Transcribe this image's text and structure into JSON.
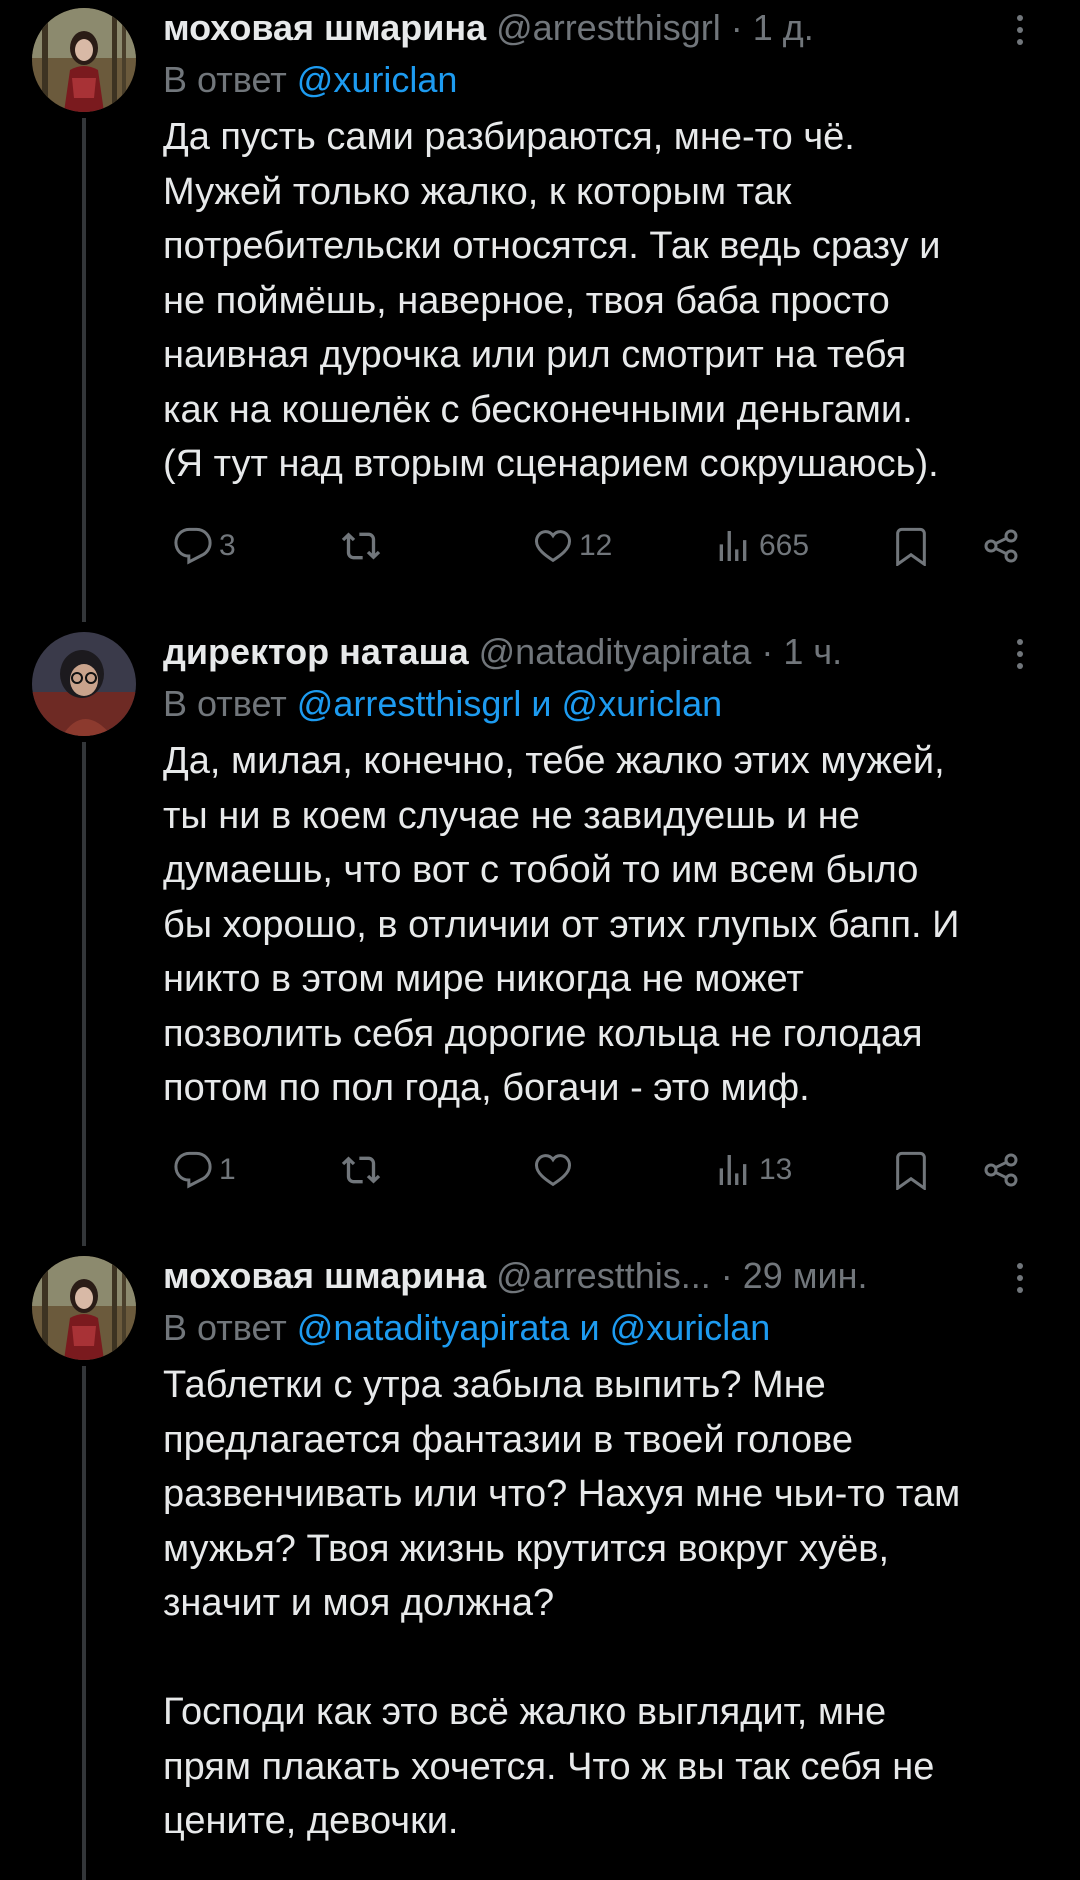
{
  "theme": {
    "background": "#000000",
    "text": "#e7e9ea",
    "muted": "#71767b",
    "accent": "#1d9bf0",
    "thread_line": "#333639"
  },
  "tweets": [
    {
      "name": "моховая шмарина",
      "handle": "@arrestthisgrl",
      "separator": "·",
      "time": "1 д.",
      "reply_prefix": "В ответ",
      "reply_mentions": [
        "@xuriclan"
      ],
      "reply_joiner": "",
      "text_lines": [
        "Да пусть сами разбираются, мне-то чё.",
        "Мужей только жалко, к которым так",
        "потребительски относятся. Так ведь сразу и",
        "не поймёшь, наверное, твоя баба просто",
        "наивная дурочка или рил смотрит на тебя",
        "как на кошелёк с бесконечными деньгами.",
        "(Я тут над вторым сценарием сокрушаюсь)."
      ],
      "replies": "3",
      "retweets": "",
      "likes": "12",
      "views": "665",
      "avatar_icon": "avatar-girl-forest"
    },
    {
      "name": "директор наташа",
      "handle": "@nataдityapirata",
      "separator": "·",
      "time": "1 ч.",
      "reply_prefix": "В ответ",
      "reply_mentions": [
        "@arrestthisgrl",
        "@xuriclan"
      ],
      "reply_joiner": "и",
      "text_lines": [
        "Да, милая, конечно, тебе жалко этих мужей,",
        "ты ни в коем случае не завидуешь и не",
        "думаешь, что вот с тобой то им всем было",
        "бы хорошо, в отличии от этих глупых бапп. И",
        "никто в этом мире никогда не может",
        "позволить себя дорогие кольца не голодая",
        "потом по пол года, богачи - это миф."
      ],
      "replies": "1",
      "retweets": "",
      "likes": "",
      "views": "13",
      "avatar_icon": "avatar-glasses"
    },
    {
      "name": "моховая шмарина",
      "handle": "@arrestthis...",
      "separator": "·",
      "time": "29 мин.",
      "reply_prefix": "В ответ",
      "reply_mentions": [
        "@natadityapirata",
        "@xuriclan"
      ],
      "reply_joiner": "и",
      "text_lines": [
        "Таблетки с утра забыла выпить? Мне",
        "предлагается фантазии в твоей голове",
        "развенчивать или что? Нахуя мне чьи-то там",
        "мужья? Твоя жизнь крутится вокруг хуёв,",
        "значит и моя должна?",
        "",
        "Господи как это всё жалко выглядит, мне",
        "прям плакать хочется. Что ж вы так себя не",
        "цените, девочки."
      ],
      "replies": "",
      "retweets": "",
      "likes": "",
      "views": "",
      "avatar_icon": "avatar-girl-forest"
    }
  ],
  "icons": {
    "reply": "reply-icon",
    "retweet": "retweet-icon",
    "like": "heart-icon",
    "views": "views-icon",
    "bookmark": "bookmark-icon",
    "share": "share-icon",
    "more": "more-icon"
  }
}
